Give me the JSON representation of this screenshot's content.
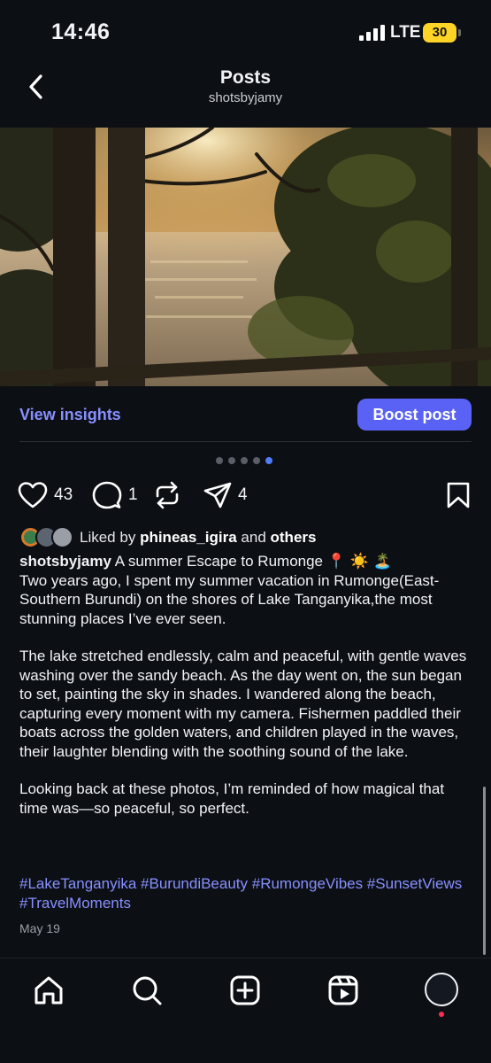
{
  "status_bar": {
    "time": "14:46",
    "network": "LTE",
    "battery": "30"
  },
  "header": {
    "title": "Posts",
    "subtitle": "shotsbyjamy"
  },
  "photo": {
    "description": "sunset-over-lake-through-trees",
    "carousel_index": 5,
    "carousel_total": 5
  },
  "insights": {
    "view_label": "View insights",
    "boost_label": "Boost post"
  },
  "actions": {
    "likes": "43",
    "comments": "1",
    "shares": "4"
  },
  "liked_by": {
    "prefix": "Liked by",
    "user": "phineas_igira",
    "joiner": "and",
    "others": "others"
  },
  "caption": {
    "username": "shotsbyjamy",
    "headline": "A summer Escape to Rumonge 📍 ☀️ 🏝️",
    "line1": "Two years ago, I spent my summer vacation in Rumonge(East-Southern Burundi) on the shores of Lake Tanganyika,the most stunning places I’ve ever seen.",
    "para2": "The lake stretched endlessly, calm and peaceful, with gentle waves washing over the sandy beach. As the day went on, the sun began to set, painting the sky in shades. I wandered along the beach, capturing every moment with my camera. Fishermen paddled their boats across the golden waters, and children played in the waves, their laughter blending with the soothing sound of the lake.",
    "para3": "Looking back at these photos, I’m reminded of how magical that time was—so peaceful, so perfect."
  },
  "hashtags": "#LakeTanganyika #BurundiBeauty #RumongeVibes #SunsetViews #TravelMoments",
  "date": "May 19",
  "colors": {
    "accent": "#8790ff",
    "boost": "#5a62f5",
    "background": "#0c0f14",
    "battery": "#ffd426",
    "active_dot": "#4f7cf7"
  },
  "tabbar": {
    "icons": [
      "home-icon",
      "search-icon",
      "create-icon",
      "reels-icon",
      "profile-avatar"
    ]
  }
}
